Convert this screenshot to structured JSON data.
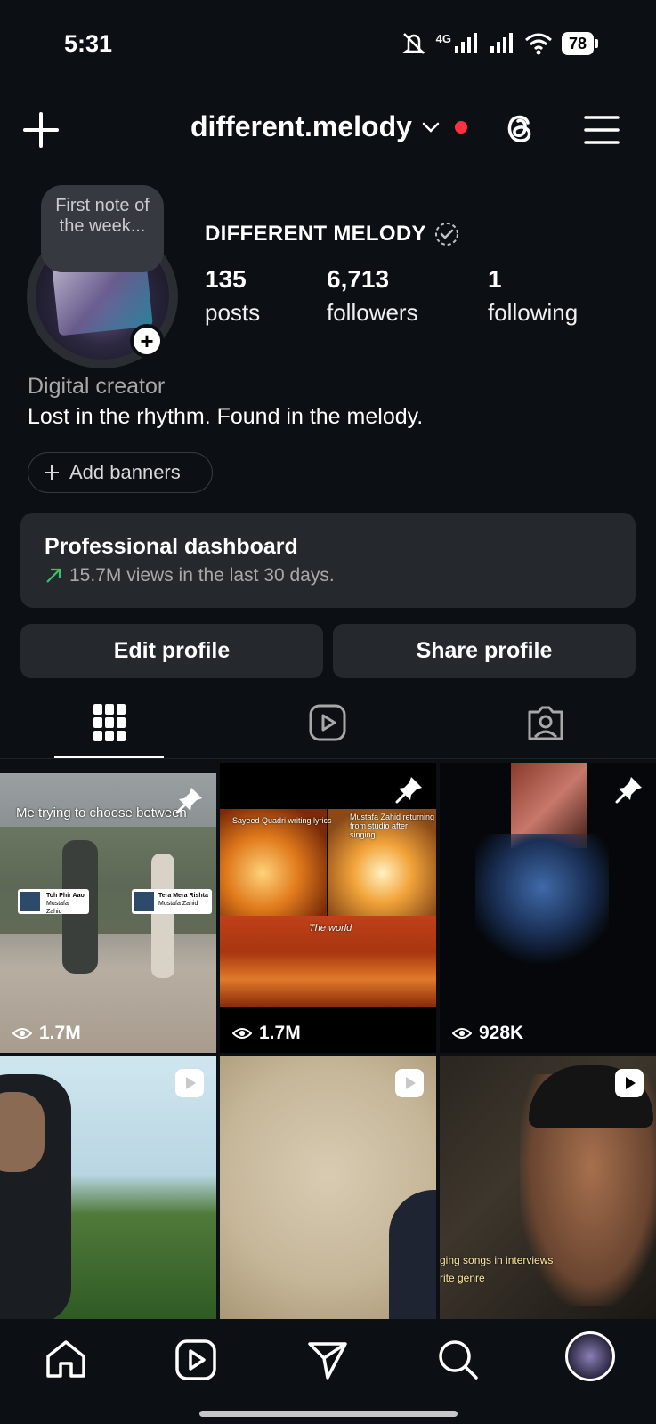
{
  "status_bar": {
    "time": "5:31",
    "network": "4G",
    "battery": "78"
  },
  "header": {
    "username": "different.melody",
    "icons": [
      "plus-icon",
      "chevron-down-icon",
      "threads-icon",
      "menu-icon"
    ]
  },
  "profile": {
    "note": "First note of the week...",
    "display_name": "DIFFERENT MELODY",
    "stats": {
      "posts": {
        "value": "135",
        "label": "posts"
      },
      "followers": {
        "value": "6,713",
        "label": "followers"
      },
      "following": {
        "value": "1",
        "label": "following"
      }
    },
    "category": "Digital creator",
    "bio": "Lost in the rhythm. Found in the melody.",
    "add_banners": "Add banners"
  },
  "dashboard": {
    "title": "Professional dashboard",
    "subtitle": "15.7M views in the last 30 days."
  },
  "actions": {
    "edit": "Edit profile",
    "share": "Share profile"
  },
  "tabs": [
    "grid-icon",
    "reels-icon",
    "tagged-icon"
  ],
  "grid": {
    "tiles": [
      {
        "views": "1.7M",
        "badge": "pin-icon",
        "caption": "Me trying to choose between",
        "song_a": "Toh Phir Aao",
        "song_a_artist": "Mustafa Zahid",
        "song_b": "Tera Mera Rishta",
        "song_b_artist": "Mustafa Zahid"
      },
      {
        "views": "1.7M",
        "badge": "pin-icon",
        "caption_a": "Sayeed Quadri writing lyrics",
        "caption_b": "Mustafa Zahid returning from studio after singing",
        "caption_c": "The world"
      },
      {
        "views": "928K",
        "badge": "pin-icon"
      },
      {
        "badge": "reel-icon"
      },
      {
        "badge": "reel-icon"
      },
      {
        "badge": "reel-icon",
        "caption_a": "ging songs in interviews",
        "caption_b": "rite genre"
      }
    ]
  },
  "colors": {
    "background": "#0c1014",
    "card": "#25292e",
    "accent_red": "#ff3040",
    "trend_green": "#3ec06a"
  }
}
